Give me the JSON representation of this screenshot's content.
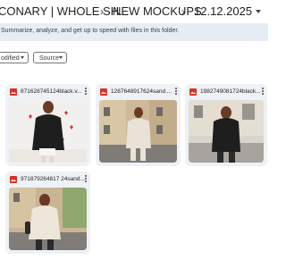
{
  "breadcrumb": {
    "segments": [
      "CONARY | WHOLE SH...",
      "NEW MOCKUPS",
      "12.12.2025"
    ],
    "separator": "›"
  },
  "banner": {
    "text": "Summarize, analyze, and get up to speed with files in this folder."
  },
  "filters": {
    "modified_label": "odified",
    "source_label": "Source"
  },
  "files": [
    {
      "name": "871628745124black.v...",
      "icon": "image-file-icon"
    },
    {
      "name": "1287648917624sand....",
      "icon": "image-file-icon"
    },
    {
      "name": "1982749081724black...",
      "icon": "image-file-icon"
    },
    {
      "name": "971879264817 24sand...",
      "icon": "image-file-icon"
    }
  ],
  "colors": {
    "banner_bg": "#e8edf5",
    "card_bg": "#eef1f5",
    "file_icon_red": "#d93025"
  }
}
